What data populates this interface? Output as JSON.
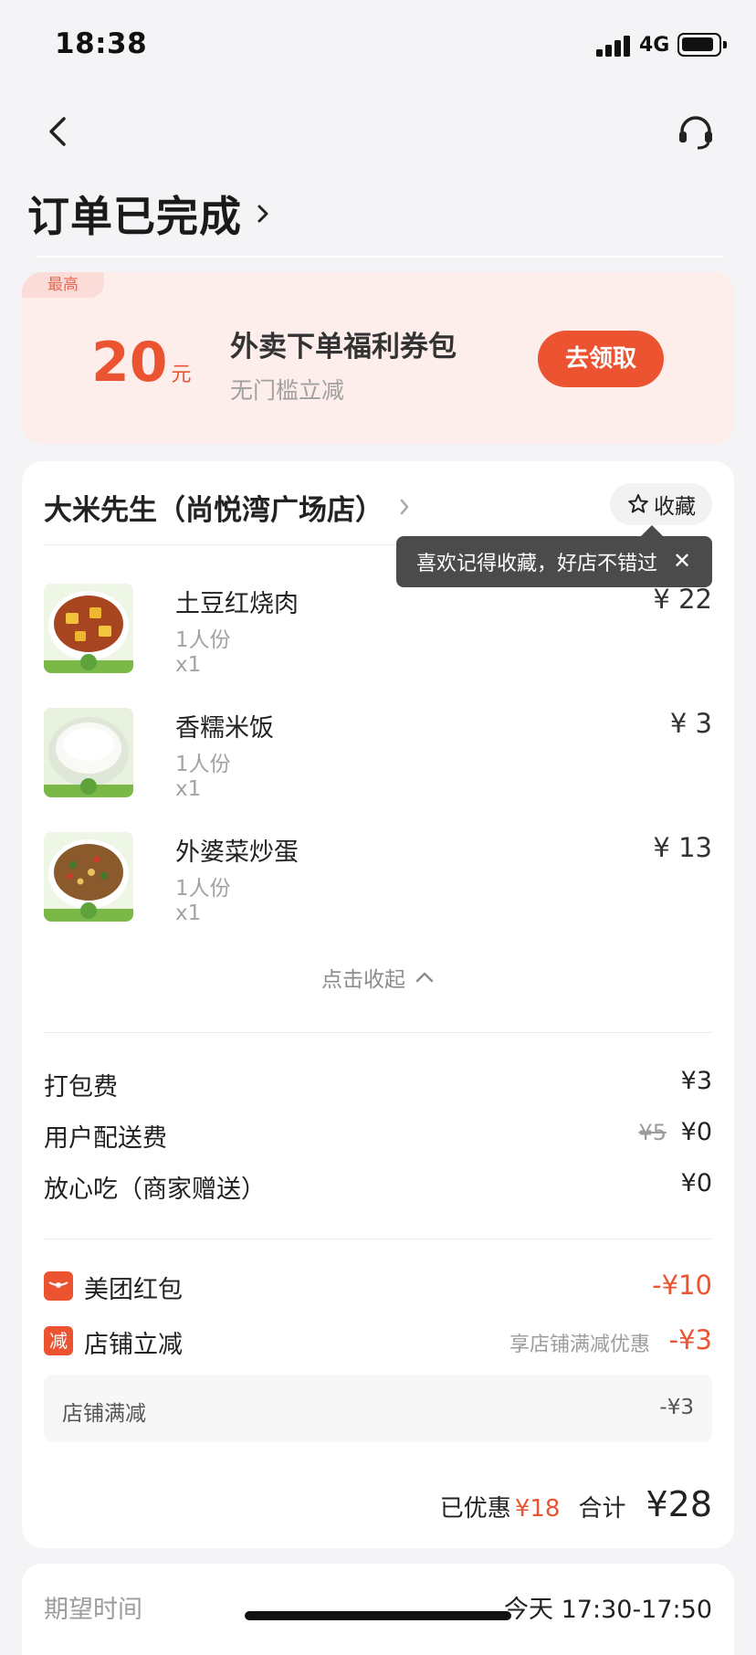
{
  "status_bar": {
    "time": "18:38",
    "network": "4G"
  },
  "header": {
    "title": "订单已完成",
    "back_icon": "chevron-left-icon",
    "support_icon": "headset-icon"
  },
  "coupon": {
    "tag": "最高",
    "amount": "20",
    "unit": "元",
    "title": "外卖下单福利券包",
    "subtitle": "无门槛立减",
    "button": "去领取"
  },
  "shop": {
    "name": "大米先生（尚悦湾广场店）",
    "favorite_label": "收藏",
    "tooltip": "喜欢记得收藏，好店不错过",
    "tooltip_close": "✕"
  },
  "items": [
    {
      "name": "土豆红烧肉",
      "portion": "1人份",
      "qty": "x1",
      "price": "¥ 22"
    },
    {
      "name": "香糯米饭",
      "portion": "1人份",
      "qty": "x1",
      "price": "¥ 3"
    },
    {
      "name": "外婆菜炒蛋",
      "portion": "1人份",
      "qty": "x1",
      "price": "¥ 13"
    }
  ],
  "collapse_label": "点击收起",
  "fees": [
    {
      "label": "打包费",
      "value": "¥3"
    },
    {
      "label": "用户配送费",
      "original": "¥5",
      "value": "¥0"
    },
    {
      "label": "放心吃（商家赠送）",
      "value": "¥0"
    }
  ],
  "discounts": {
    "redpacket": {
      "label": "美团红包",
      "value": "-¥10"
    },
    "shop_cut": {
      "icon_text": "减",
      "label": "店铺立减",
      "note": "享店铺满减优惠",
      "value": "-¥3"
    },
    "sub": {
      "label": "店铺满减",
      "value": "-¥3"
    }
  },
  "totals": {
    "saved_label": "已优惠",
    "saved_value": "¥18",
    "total_label": "合计",
    "total_value": "¥28"
  },
  "expected": {
    "label": "期望时间",
    "value": "今天 17:30-17:50"
  },
  "colors": {
    "accent": "#ec5330",
    "coupon_bg": "#fdeeec",
    "page_bg": "#f4f4f6"
  }
}
